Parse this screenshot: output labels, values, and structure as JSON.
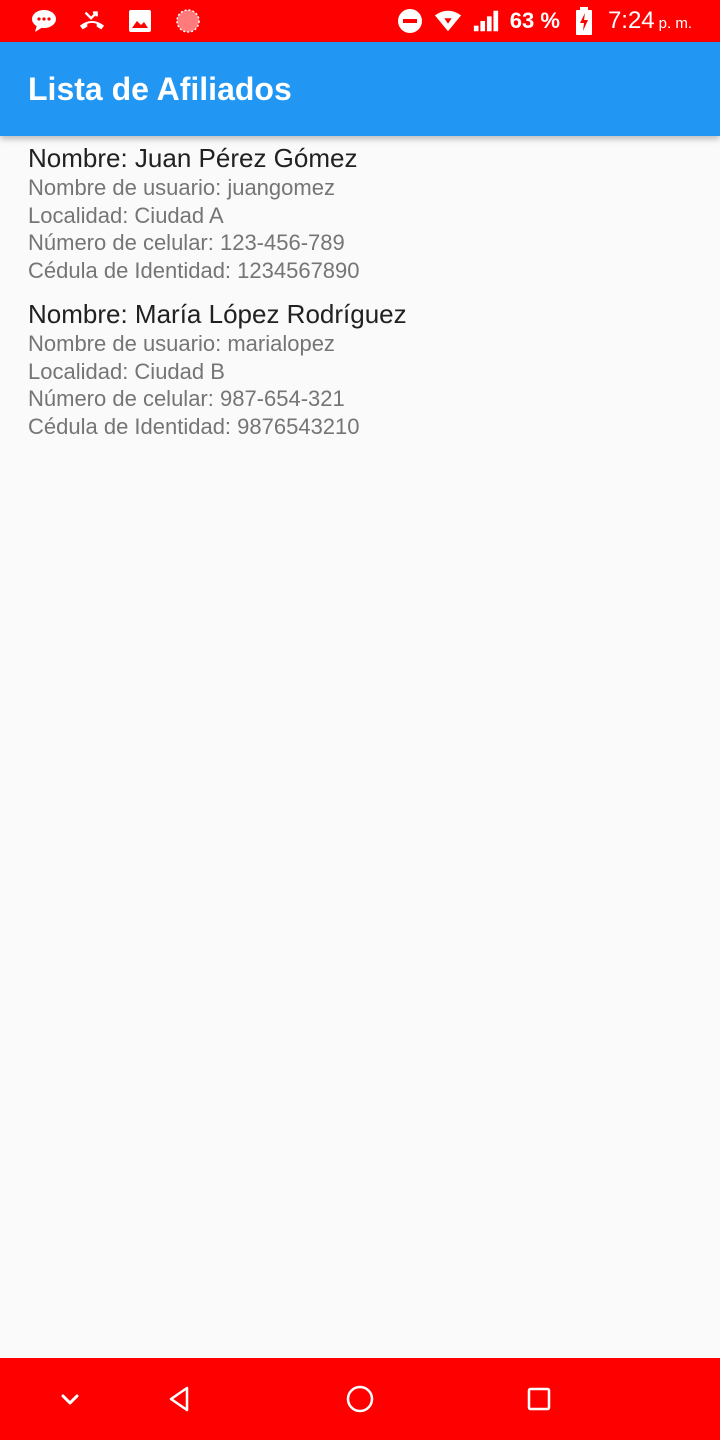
{
  "status_bar": {
    "battery_percent": "63 %",
    "time": "7:24",
    "ampm": "p. m.",
    "icons_left": [
      "chat-bubble-icon",
      "missed-call-icon",
      "image-icon",
      "circle-indicator-icon"
    ],
    "icons_right": [
      "do-not-disturb-icon",
      "wifi-icon",
      "signal-icon",
      "battery-charging-icon"
    ]
  },
  "app_bar": {
    "title": "Lista de Afiliados",
    "color": "#2196f3"
  },
  "affiliates": [
    {
      "name": "Nombre: Juan Pérez Gómez",
      "username": "Nombre de usuario: juangomez",
      "locality": "Localidad: Ciudad A",
      "phone": "Número de celular: 123-456-789",
      "id_card": "Cédula de Identidad: 1234567890"
    },
    {
      "name": "Nombre: María López Rodríguez",
      "username": "Nombre de usuario: marialopez",
      "locality": "Localidad: Ciudad B",
      "phone": "Número de celular: 987-654-321",
      "id_card": "Cédula de Identidad: 9876543210"
    }
  ],
  "nav_bar": {
    "color": "#ff0000",
    "buttons": [
      "collapse-icon",
      "back-icon",
      "home-icon",
      "recents-icon"
    ]
  }
}
